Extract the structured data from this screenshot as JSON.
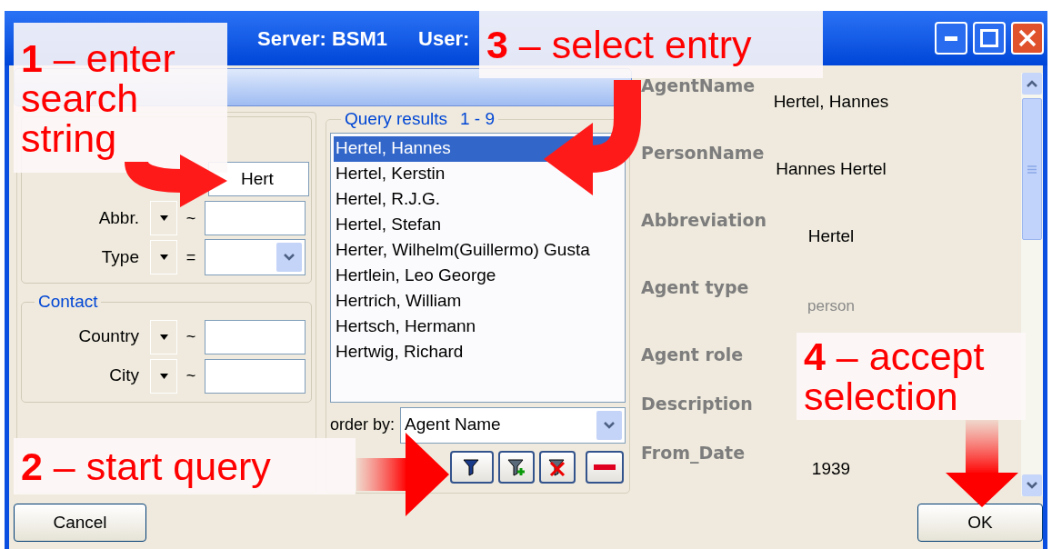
{
  "title_bar": {
    "server": "Server: BSM1",
    "user": "User:"
  },
  "query_conditions": {
    "groups": [
      {
        "rows": [
          {
            "value": "Hert",
            "kind": "text"
          },
          {
            "label": "Abbr.",
            "operator": "~",
            "kind": "text"
          },
          {
            "label": "Type",
            "operator": "=",
            "kind": "select"
          }
        ]
      },
      {
        "title": "Contact",
        "rows": [
          {
            "label": "Country",
            "operator": "~",
            "kind": "text"
          },
          {
            "label": "City",
            "operator": "~",
            "kind": "text"
          }
        ]
      }
    ]
  },
  "query_results": {
    "title": "Query results",
    "count": "1 - 9",
    "items": [
      {
        "label": "Hertel, Hannes",
        "selected": true
      },
      {
        "label": "Hertel, Kerstin",
        "selected": false
      },
      {
        "label": "Hertel, R.J.G.",
        "selected": false
      },
      {
        "label": "Hertel, Stefan",
        "selected": false
      },
      {
        "label": "Herter, Wilhelm(Guillermo) Gusta",
        "selected": false
      },
      {
        "label": "Hertlein, Leo George",
        "selected": false
      },
      {
        "label": "Hertrich, William",
        "selected": false
      },
      {
        "label": "Hertsch, Hermann",
        "selected": false
      },
      {
        "label": "Hertwig, Richard",
        "selected": false
      }
    ],
    "order_by": {
      "label": "order by:",
      "value": "Agent Name"
    }
  },
  "details": [
    {
      "label": "AgentName",
      "value": "Hertel, Hannes",
      "dimmed": false
    },
    {
      "label": "PersonName",
      "value": "Hannes Hertel",
      "dimmed": false
    },
    {
      "label": "Abbreviation",
      "value": "Hertel",
      "dimmed": false
    },
    {
      "label": "Agent type",
      "value": "person",
      "dimmed": true
    },
    {
      "label": "Agent role"
    },
    {
      "label": "Description"
    },
    {
      "label": "From_Date",
      "value": "1939",
      "dimmed": false
    }
  ],
  "buttons": {
    "cancel": "Cancel",
    "ok": "OK"
  },
  "annotations": [
    {
      "text": "**1** – enter search string"
    },
    {
      "text": "**3** – select entry"
    },
    {
      "text": "**2** – start query"
    },
    {
      "text": "**4** – accept selection"
    }
  ]
}
